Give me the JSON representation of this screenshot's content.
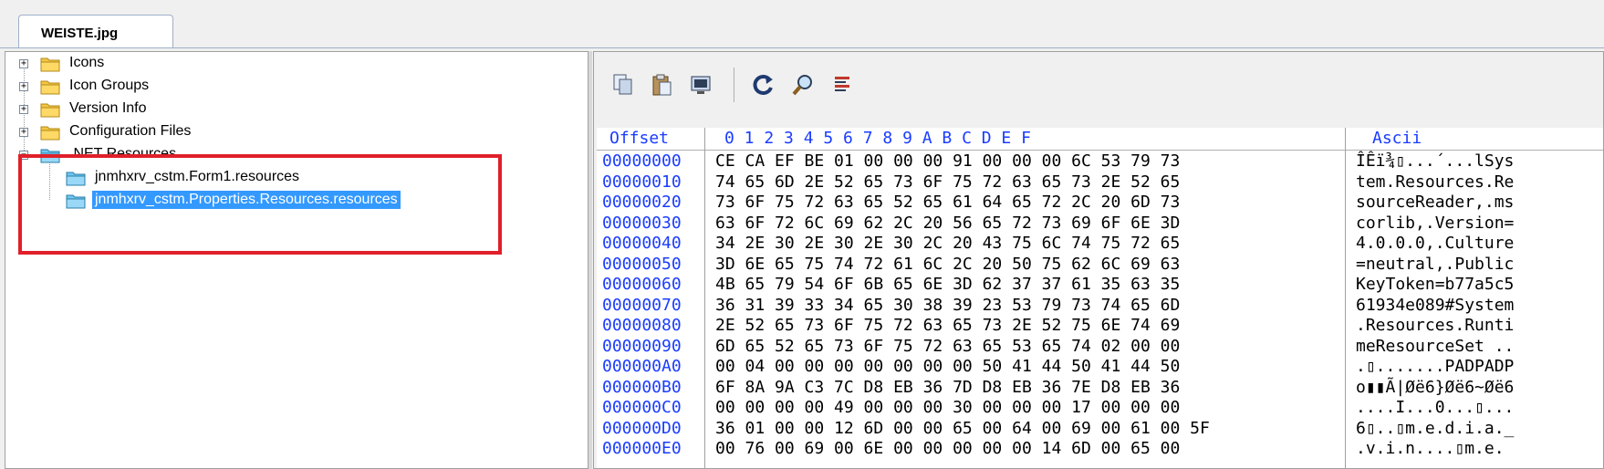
{
  "tab": {
    "label": "WEISTE.jpg"
  },
  "tree": {
    "items": [
      {
        "label": "Icons",
        "expander": "+",
        "level": 0
      },
      {
        "label": "Icon Groups",
        "expander": "+",
        "level": 0
      },
      {
        "label": "Version Info",
        "expander": "+",
        "level": 0
      },
      {
        "label": "Configuration Files",
        "expander": "+",
        "level": 0
      },
      {
        "label": ".NET Resources",
        "expander": "−",
        "level": 0
      },
      {
        "label": "jnmhxrv_cstm.Form1.resources",
        "level": 1
      },
      {
        "label": "jnmhxrv_cstm.Properties.Resources.resources",
        "level": 1,
        "selected": true
      }
    ]
  },
  "toolbar": {
    "buttons": [
      {
        "name": "copy-icon",
        "glyph": "⎘"
      },
      {
        "name": "paste-icon",
        "glyph": "📋"
      },
      {
        "name": "view-icon",
        "glyph": "▣"
      },
      {
        "name": "refresh-icon",
        "glyph": "↻"
      },
      {
        "name": "search-icon",
        "glyph": "⌕"
      },
      {
        "name": "list-icon",
        "glyph": "☰"
      }
    ]
  },
  "hex": {
    "header": {
      "offset": "Offset",
      "columns": "0  1  2  3  4  5  6  7  8  9  A  B  C  D  E  F",
      "ascii": "Ascii"
    },
    "rows": [
      {
        "offset": "00000000",
        "bytes": "CE CA EF BE 01 00 00 00 91 00 00 00 6C 53 79 73",
        "ascii": "ÎÊï¾▯...´...lSys"
      },
      {
        "offset": "00000010",
        "bytes": "74 65 6D 2E 52 65 73 6F 75 72 63 65 73 2E 52 65",
        "ascii": "tem.Resources.Re"
      },
      {
        "offset": "00000020",
        "bytes": "73 6F 75 72 63 65 52 65 61 64 65 72 2C 20 6D 73",
        "ascii": "sourceReader,.ms"
      },
      {
        "offset": "00000030",
        "bytes": "63 6F 72 6C 69 62 2C 20 56 65 72 73 69 6F 6E 3D",
        "ascii": "corlib,.Version="
      },
      {
        "offset": "00000040",
        "bytes": "34 2E 30 2E 30 2E 30 2C 20 43 75 6C 74 75 72 65",
        "ascii": "4.0.0.0,.Culture"
      },
      {
        "offset": "00000050",
        "bytes": "3D 6E 65 75 74 72 61 6C 2C 20 50 75 62 6C 69 63",
        "ascii": "=neutral,.Public"
      },
      {
        "offset": "00000060",
        "bytes": "4B 65 79 54 6F 6B 65 6E 3D 62 37 37 61 35 63 35",
        "ascii": "KeyToken=b77a5c5"
      },
      {
        "offset": "00000070",
        "bytes": "36 31 39 33 34 65 30 38 39 23 53 79 73 74 65 6D",
        "ascii": "61934e089#System"
      },
      {
        "offset": "00000080",
        "bytes": "2E 52 65 73 6F 75 72 63 65 73 2E 52 75 6E 74 69",
        "ascii": ".Resources.Runti"
      },
      {
        "offset": "00000090",
        "bytes": "6D 65 52 65 73 6F 75 72 63 65 53 65 74 02 00 00",
        "ascii": "meResourceSet .."
      },
      {
        "offset": "000000A0",
        "bytes": "00 04 00 00 00 00 00 00 00 50 41 44 50 41 44 50",
        "ascii": ".▯.......PADPADP"
      },
      {
        "offset": "000000B0",
        "bytes": "6F 8A 9A C3 7C D8 EB 36 7D D8 EB 36 7E D8 EB 36",
        "ascii": "o▮▮Ã|Øë6}Øë6~Øë6"
      },
      {
        "offset": "000000C0",
        "bytes": "00 00 00 00 49 00 00 00 30 00 00 00 17 00 00 00",
        "ascii": "....I...0...▯..."
      },
      {
        "offset": "000000D0",
        "bytes": "36 01 00 00 12 6D 00 00 65 00 64 00 69 00 61 00 5F",
        "ascii": "6▯..▯m.e.d.i.a._"
      },
      {
        "offset": "000000E0",
        "bytes": "00 76 00 69 00 6E 00 00 00 00 00 14 6D 00 65 00",
        "ascii": ".v.i.n....▯m.e."
      }
    ]
  },
  "colors": {
    "selection": "#3399ff",
    "offset_text": "#1a3cff",
    "highlight_box": "#e0202a"
  }
}
